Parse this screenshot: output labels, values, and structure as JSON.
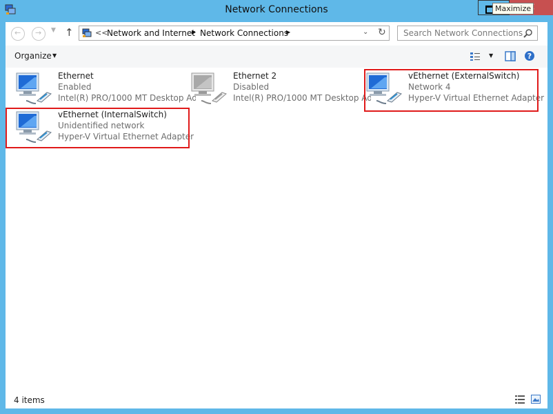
{
  "window": {
    "title": "Network Connections",
    "tooltip": "Maximize"
  },
  "address": {
    "overflow": "<<",
    "crumbs": [
      "Network and Internet",
      "Network Connections"
    ]
  },
  "search": {
    "placeholder": "Search Network Connections"
  },
  "toolbar": {
    "organize_label": "Organize"
  },
  "connections": [
    {
      "name": "Ethernet",
      "status": "Enabled",
      "device": "Intel(R) PRO/1000 MT Desktop Ad...",
      "state": "enabled",
      "highlighted": false
    },
    {
      "name": "Ethernet 2",
      "status": "Disabled",
      "device": "Intel(R) PRO/1000 MT Desktop Ad...",
      "state": "disabled",
      "highlighted": false
    },
    {
      "name": "vEthernet (ExternalSwitch)",
      "status": "Network  4",
      "device": "Hyper-V Virtual Ethernet Adapter ...",
      "state": "enabled",
      "highlighted": true
    },
    {
      "name": "vEthernet (InternalSwitch)",
      "status": "Unidentified network",
      "device": "Hyper-V Virtual Ethernet Adapter ...",
      "state": "enabled",
      "highlighted": true
    }
  ],
  "status": {
    "item_count": "4 items"
  },
  "colors": {
    "window_frame": "#5fb8e8",
    "close_button": "#c75050",
    "highlight": "#e01919",
    "secondary_text": "#6d6d6d"
  },
  "icons": [
    "network-connections-app-icon",
    "back-arrow-icon",
    "forward-arrow-icon",
    "up-arrow-icon",
    "refresh-icon",
    "search-icon",
    "change-view-icon",
    "preview-pane-icon",
    "help-icon",
    "network-adapter-icon",
    "details-view-icon",
    "large-icons-view-icon"
  ]
}
